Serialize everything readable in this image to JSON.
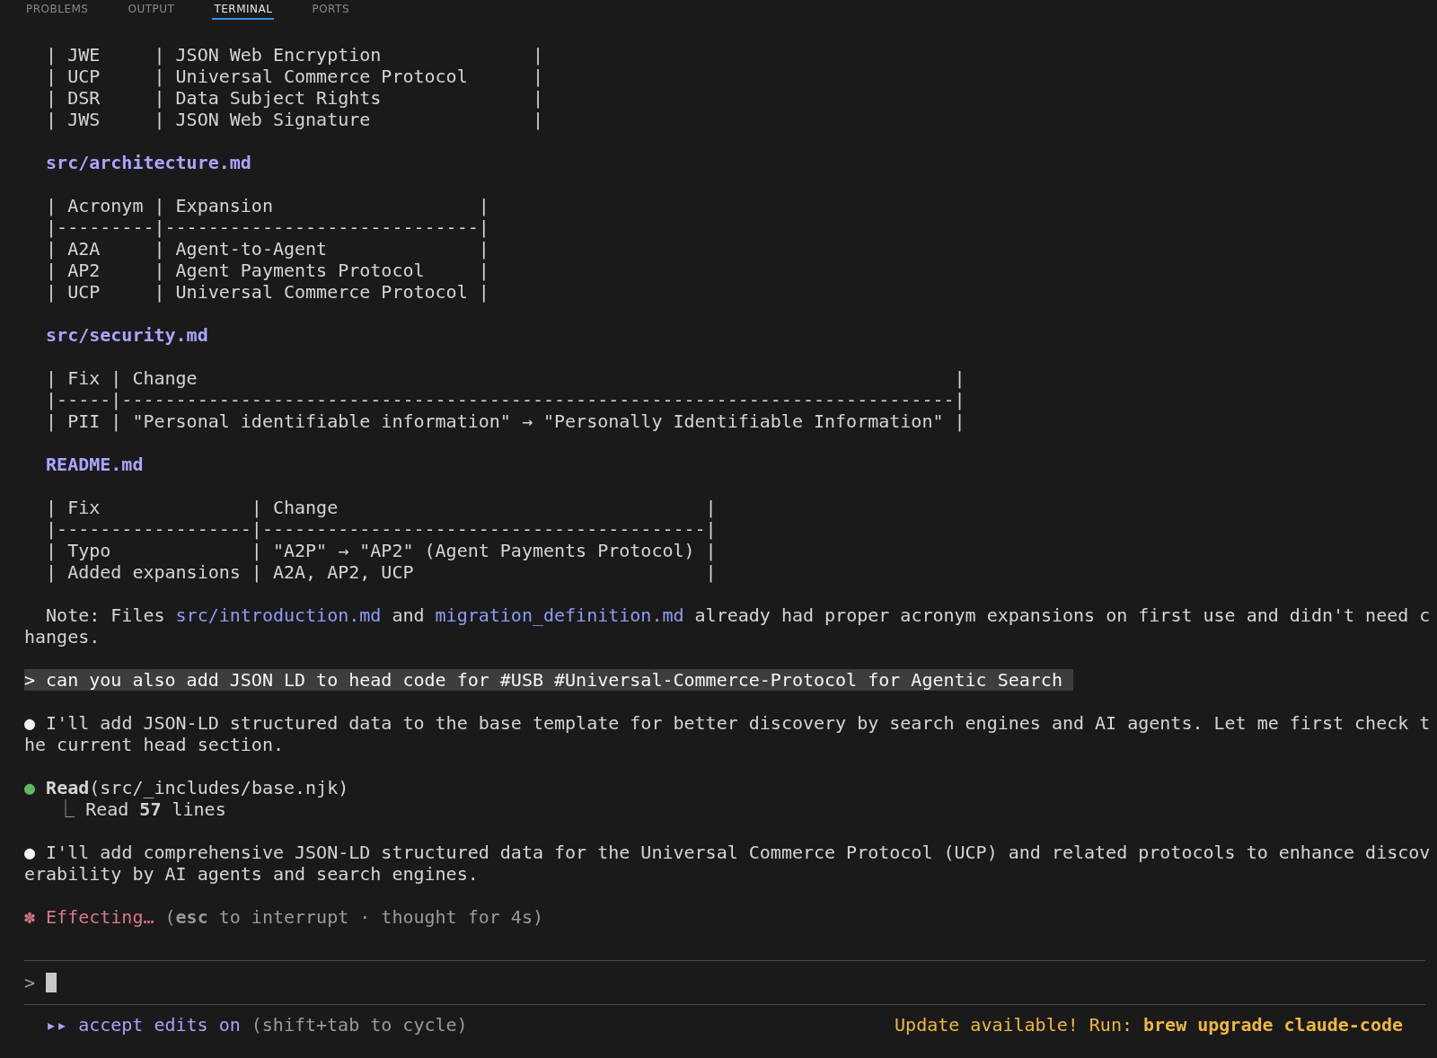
{
  "panel_tabs": [
    {
      "label": "PROBLEMS",
      "selected": false
    },
    {
      "label": "OUTPUT",
      "selected": false
    },
    {
      "label": "TERMINAL",
      "selected": true
    },
    {
      "label": "PORTS",
      "selected": false
    }
  ],
  "blocks": [
    {
      "kind": "table",
      "rows": [
        "| JWE     | JSON Web Encryption              |",
        "| UCP     | Universal Commerce Protocol      |",
        "| DSR     | Data Subject Rights              |",
        "| JWS     | JSON Web Signature               |"
      ]
    },
    {
      "kind": "heading",
      "text": "src/architecture.md"
    },
    {
      "kind": "table",
      "rows": [
        "| Acronym | Expansion                   |",
        "|---------|-----------------------------|",
        "| A2A     | Agent-to-Agent              |",
        "| AP2     | Agent Payments Protocol     |",
        "| UCP     | Universal Commerce Protocol |"
      ]
    },
    {
      "kind": "heading",
      "text": "src/security.md"
    },
    {
      "kind": "table",
      "rows": [
        "| Fix | Change                                                                      |",
        "|-----|-----------------------------------------------------------------------------|",
        "| PII | \"Personal identifiable information\" → \"Personally Identifiable Information\" |"
      ]
    },
    {
      "kind": "heading",
      "text": "README.md"
    },
    {
      "kind": "table",
      "rows": [
        "| Fix              | Change                                  |",
        "|------------------|-----------------------------------------|",
        "| Typo             | \"A2P\" → \"AP2\" (Agent Payments Protocol) |",
        "| Added expansions | A2A, AP2, UCP                           |"
      ]
    },
    {
      "kind": "note",
      "segments": [
        {
          "kind": "text",
          "text": "Note: Files "
        },
        {
          "kind": "link",
          "text": "src/introduction.md"
        },
        {
          "kind": "text",
          "text": " and "
        },
        {
          "kind": "link",
          "text": "migration_definition.md"
        },
        {
          "kind": "text",
          "text": " already had proper acronym expansions on first use and didn't need changes."
        }
      ]
    },
    {
      "kind": "prompt",
      "text": "> can you also add JSON LD to head code for #USB #Universal-Commerce-Protocol for Agentic Search"
    },
    {
      "kind": "message",
      "marker": "●",
      "color": "#f2f2f2",
      "text": "I'll add JSON-LD structured data to the base template for better discovery by search engines and AI agents. Let me first check the current head section."
    },
    {
      "kind": "tool",
      "marker": "●",
      "color": "#5fb760",
      "call": "**Read**(src/_includes/base.njk)",
      "branch": "⎿",
      "result": "Read **57** lines"
    },
    {
      "kind": "message",
      "marker": "●",
      "color": "#f2f2f2",
      "text": "I'll add comprehensive JSON-LD structured data for the Universal Commerce Protocol (UCP) and related protocols to enhance discoverability by AI agents and search engines."
    },
    {
      "kind": "status",
      "marker": "✽",
      "label": "Effecting…",
      "detail": "(**esc** to interrupt · thought for 4s)"
    }
  ],
  "input": {
    "prompt": ">"
  },
  "footer": {
    "mode_icon": "▸▸",
    "mode": "accept edits on",
    "hint": "(shift+tab to cycle)",
    "update": "Update available! Run: **brew upgrade claude-code**"
  }
}
